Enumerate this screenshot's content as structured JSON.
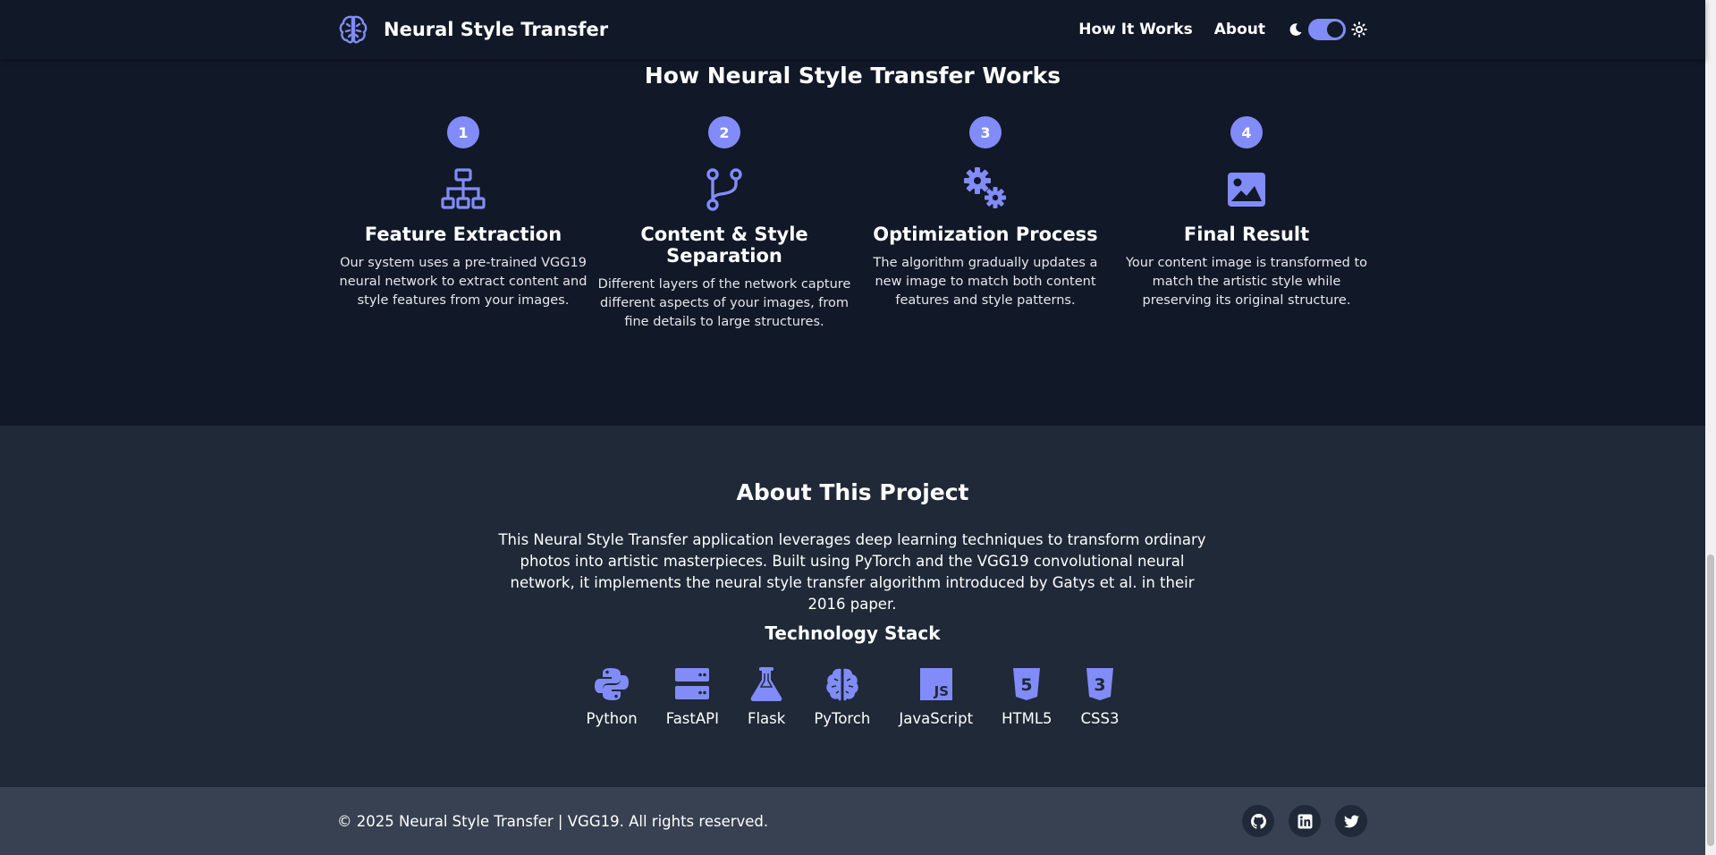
{
  "navbar": {
    "brand": "Neural Style Transfer",
    "brand_icon": "brain-icon",
    "links": [
      "How It Works",
      "About"
    ],
    "theme_toggle": {
      "dark_icon": "moon-icon",
      "light_icon": "sun-icon",
      "state": "on"
    }
  },
  "how": {
    "title": "How Neural Style Transfer Works",
    "steps": [
      {
        "number": "1",
        "icon": "network-icon",
        "title": "Feature Extraction",
        "description": "Our system uses a pre-trained VGG19 neural network to extract content and style features from your images."
      },
      {
        "number": "2",
        "icon": "code-branch-icon",
        "title": "Content & Style Separation",
        "description": "Different layers of the network capture different aspects of your images, from fine details to large structures."
      },
      {
        "number": "3",
        "icon": "cogs-icon",
        "title": "Optimization Process",
        "description": "The algorithm gradually updates a new image to match both content features and style patterns."
      },
      {
        "number": "4",
        "icon": "image-icon",
        "title": "Final Result",
        "description": "Your content image is transformed to match the artistic style while preserving its original structure."
      }
    ]
  },
  "about": {
    "title": "About This Project",
    "text": "This Neural Style Transfer application leverages deep learning techniques to transform ordinary photos into artistic masterpieces. Built using PyTorch and the VGG19 convolutional neural network, it implements the neural style transfer algorithm introduced by Gatys et al. in their 2016 paper.",
    "tech_title": "Technology Stack",
    "tech": [
      {
        "label": "Python",
        "icon": "python-icon"
      },
      {
        "label": "FastAPI",
        "icon": "server-icon"
      },
      {
        "label": "Flask",
        "icon": "flask-icon"
      },
      {
        "label": "PyTorch",
        "icon": "brain-icon"
      },
      {
        "label": "JavaScript",
        "icon": "js-icon"
      },
      {
        "label": "HTML5",
        "icon": "html5-icon"
      },
      {
        "label": "CSS3",
        "icon": "css3-icon"
      }
    ]
  },
  "footer": {
    "copyright": "© 2025 Neural Style Transfer | VGG19. All rights reserved.",
    "socials": [
      "github-icon",
      "linkedin-icon",
      "twitter-icon"
    ]
  },
  "colors": {
    "accent": "#818cf8",
    "dark_bg": "#111827",
    "section_bg": "#1f2937",
    "footer_bg": "#374151"
  }
}
